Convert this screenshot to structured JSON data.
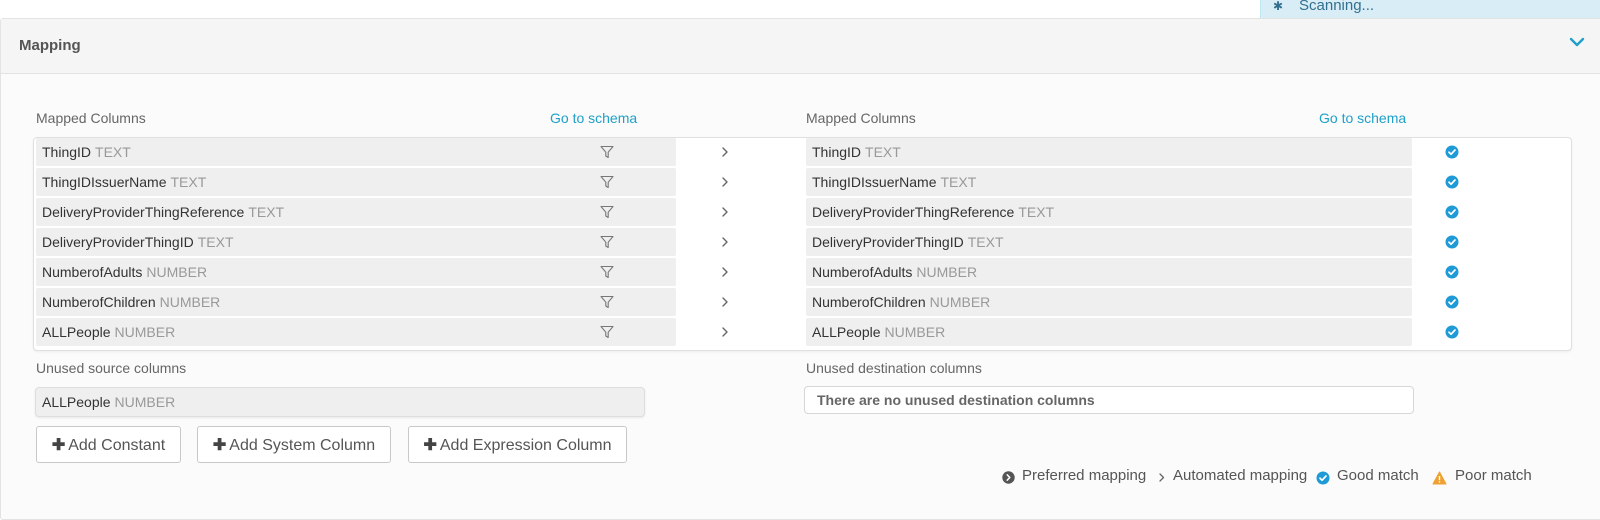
{
  "toast": {
    "text": "Scanning..."
  },
  "panel": {
    "title": "Mapping"
  },
  "source": {
    "header": "Mapped Columns",
    "schema_link": "Go to schema",
    "rows": [
      {
        "name": "ThingID",
        "type": "TEXT"
      },
      {
        "name": "ThingIDIssuerName",
        "type": "TEXT"
      },
      {
        "name": "DeliveryProviderThingReference",
        "type": "TEXT"
      },
      {
        "name": "DeliveryProviderThingID",
        "type": "TEXT"
      },
      {
        "name": "NumberofAdults",
        "type": "NUMBER"
      },
      {
        "name": "NumberofChildren",
        "type": "NUMBER"
      },
      {
        "name": "ALLPeople",
        "type": "NUMBER"
      }
    ]
  },
  "destination": {
    "header": "Mapped Columns",
    "schema_link": "Go to schema",
    "rows": [
      {
        "name": "ThingID",
        "type": "TEXT"
      },
      {
        "name": "ThingIDIssuerName",
        "type": "TEXT"
      },
      {
        "name": "DeliveryProviderThingReference",
        "type": "TEXT"
      },
      {
        "name": "DeliveryProviderThingID",
        "type": "TEXT"
      },
      {
        "name": "NumberofAdults",
        "type": "NUMBER"
      },
      {
        "name": "NumberofChildren",
        "type": "NUMBER"
      },
      {
        "name": "ALLPeople",
        "type": "NUMBER"
      }
    ]
  },
  "unused_source": {
    "label": "Unused source columns",
    "items": [
      {
        "name": "ALLPeople",
        "type": "NUMBER"
      }
    ]
  },
  "unused_destination": {
    "label": "Unused destination columns",
    "empty_text": "There are no unused destination columns"
  },
  "buttons": {
    "add_constant": "Add Constant",
    "add_system_column": "Add System Column",
    "add_expression_column": "Add Expression Column"
  },
  "legend": {
    "preferred": "Preferred mapping",
    "automated": "Automated mapping",
    "good": "Good match",
    "poor": "Poor match"
  },
  "colors": {
    "accent": "#1fa0c8",
    "check": "#1e9bd7",
    "warning": "#f0a030",
    "row_bg": "#efefef"
  }
}
